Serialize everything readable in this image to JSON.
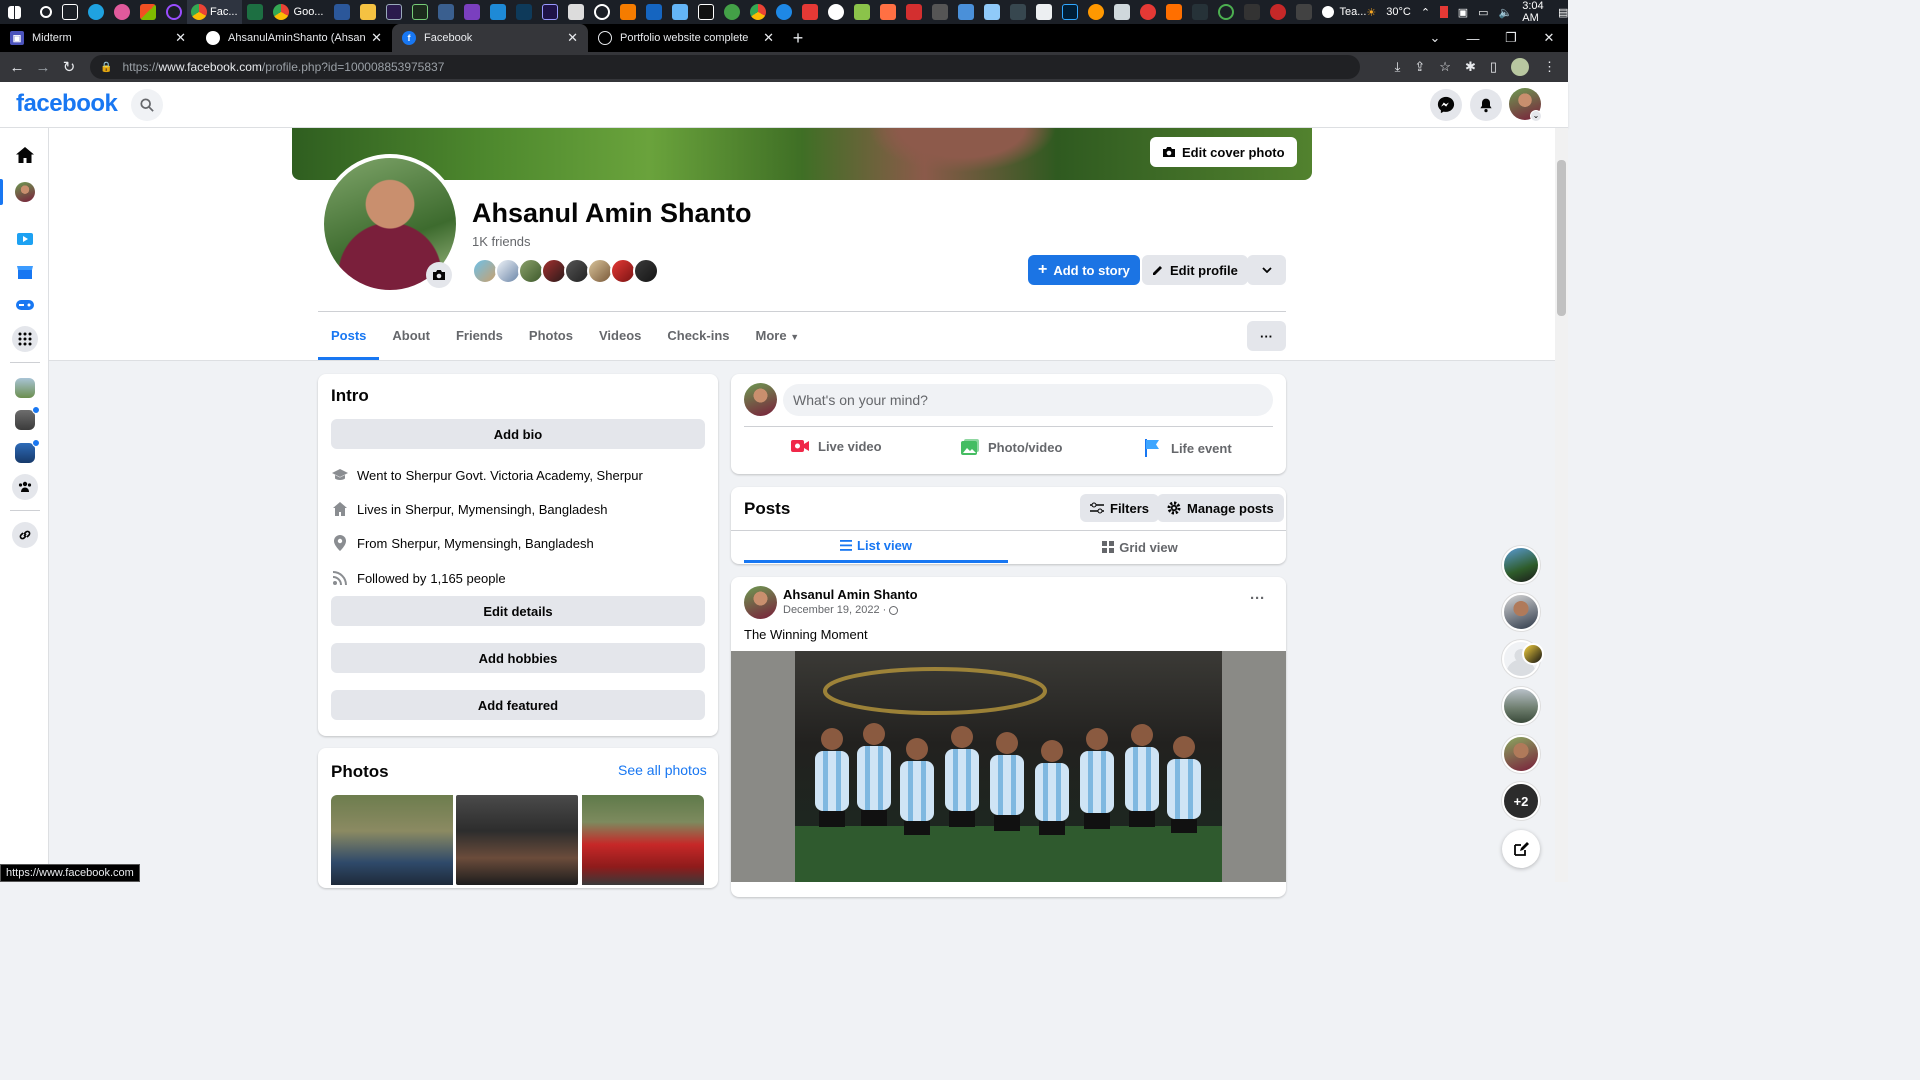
{
  "taskbar": {
    "active_app_label": "Fac...",
    "chrome_app_label": "Goo...",
    "teams_label": "Tea...",
    "temperature": "30°C",
    "time": "3:04 AM"
  },
  "browser": {
    "tabs": [
      {
        "label": "Midterm",
        "active": false
      },
      {
        "label": "AhsanulAminShanto (Ahsanul Ar",
        "active": false
      },
      {
        "label": "Facebook",
        "active": true
      },
      {
        "label": "Portfolio website complete",
        "active": false
      }
    ],
    "url_prefix": "https://",
    "url_host": "www.facebook.com",
    "url_path": "/profile.php?id=100008853975837"
  },
  "fb": {
    "logo": "facebook",
    "edit_cover_label": "Edit cover photo",
    "profile_name": "Ahsanul Amin Shanto",
    "friends_count": "1K friends",
    "add_to_story": "Add to story",
    "edit_profile": "Edit profile",
    "tabs": [
      "Posts",
      "About",
      "Friends",
      "Photos",
      "Videos",
      "Check-ins",
      "More"
    ],
    "more_menu_label": "···"
  },
  "intro": {
    "title": "Intro",
    "add_bio": "Add bio",
    "rows": [
      {
        "prefix": "Went to",
        "value": "Sherpur Govt. Victoria Academy, Sherpur",
        "icon": "graduation-cap-icon"
      },
      {
        "prefix": "Lives in",
        "value": "Sherpur, Mymensingh, Bangladesh",
        "icon": "home-icon"
      },
      {
        "prefix": "From",
        "value": "Sherpur, Mymensingh, Bangladesh",
        "icon": "location-pin-icon"
      },
      {
        "prefix": "Followed by",
        "value": "1,165 people",
        "icon": "rss-icon"
      }
    ],
    "edit_details": "Edit details",
    "add_hobbies": "Add hobbies",
    "add_featured": "Add featured"
  },
  "photos": {
    "title": "Photos",
    "see_all": "See all photos"
  },
  "composer": {
    "placeholder": "What's on your mind?",
    "live_video": "Live video",
    "photo_video": "Photo/video",
    "life_event": "Life event"
  },
  "posts": {
    "title": "Posts",
    "filters": "Filters",
    "manage": "Manage posts",
    "list_view": "List view",
    "grid_view": "Grid view"
  },
  "post": {
    "author": "Ahsanul Amin Shanto",
    "date": "December 19, 2022 · ",
    "text": "The Winning Moment"
  },
  "contacts": {
    "more_count": "+2"
  },
  "status_url": "https://www.facebook.com"
}
